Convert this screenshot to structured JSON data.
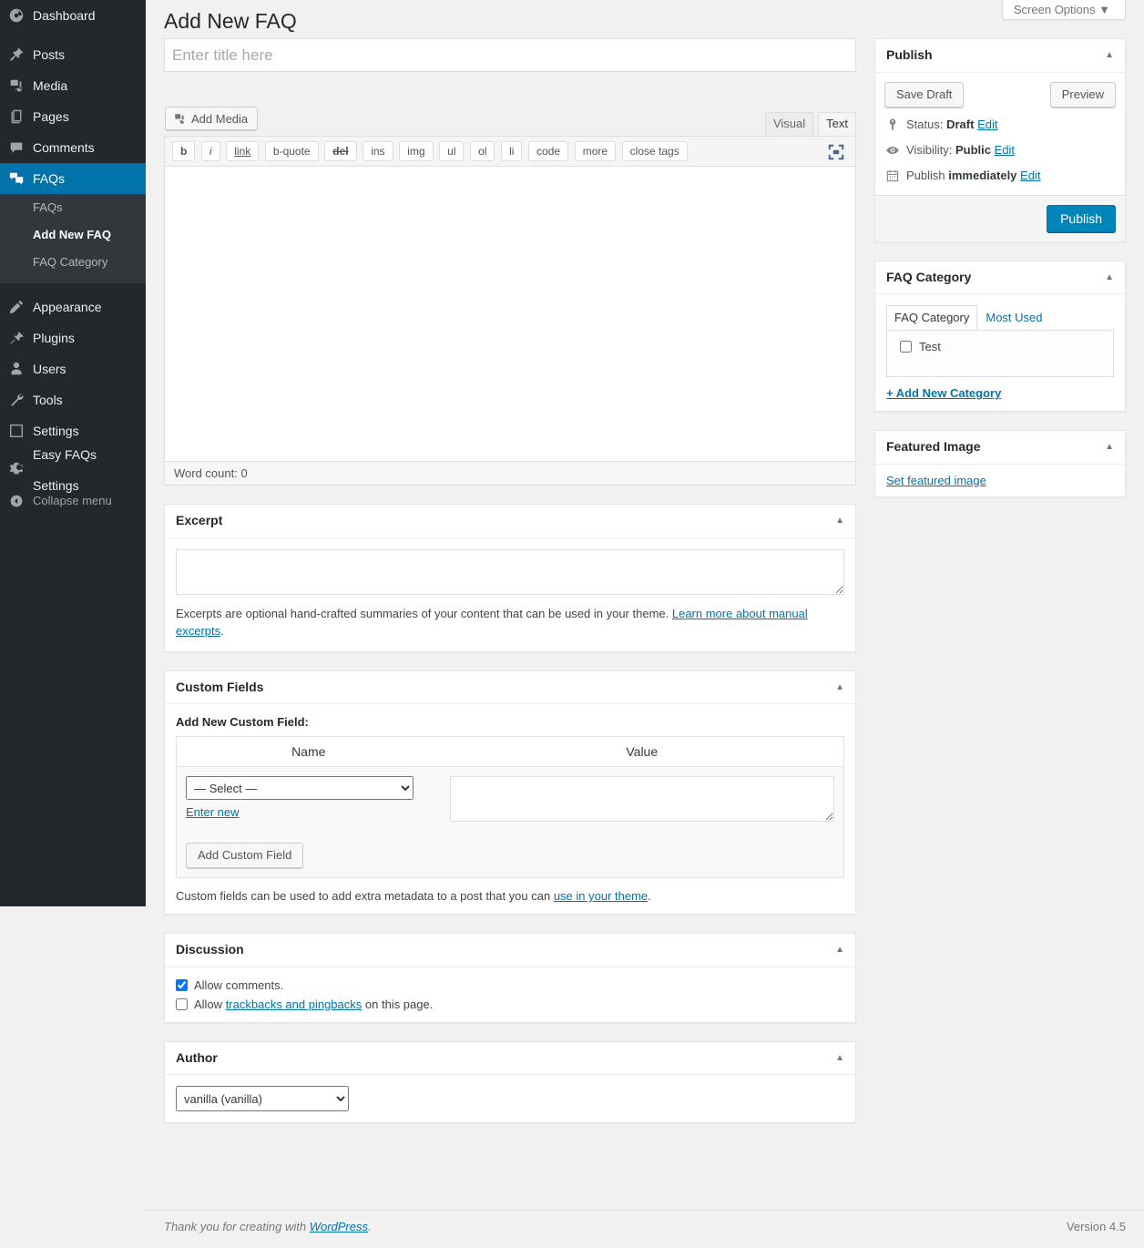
{
  "sidebar": {
    "items": [
      {
        "label": "Dashboard",
        "icon": "dashboard-icon"
      },
      {
        "label": "Posts",
        "icon": "pin-icon"
      },
      {
        "label": "Media",
        "icon": "media-icon"
      },
      {
        "label": "Pages",
        "icon": "pages-icon"
      },
      {
        "label": "Comments",
        "icon": "comments-icon"
      },
      {
        "label": "FAQs",
        "icon": "faqs-icon"
      },
      {
        "label": "Appearance",
        "icon": "appearance-icon"
      },
      {
        "label": "Plugins",
        "icon": "plugins-icon"
      },
      {
        "label": "Users",
        "icon": "users-icon"
      },
      {
        "label": "Tools",
        "icon": "tools-icon"
      },
      {
        "label": "Settings",
        "icon": "settings-icon"
      },
      {
        "label": "Easy FAQs Settings",
        "icon": "gear-icon"
      }
    ],
    "submenu": [
      {
        "label": "FAQs"
      },
      {
        "label": "Add New FAQ"
      },
      {
        "label": "FAQ Category"
      }
    ],
    "collapse_label": "Collapse menu",
    "active_item": "FAQs",
    "active_submenu": "Add New FAQ",
    "accent_color": "#0073aa",
    "background_color": "#23282d",
    "submenu_background": "#32373c"
  },
  "header": {
    "screen_options_label": "Screen Options",
    "page_title": "Add New FAQ"
  },
  "title_field": {
    "placeholder": "Enter title here",
    "value": ""
  },
  "editor": {
    "add_media_label": "Add Media",
    "tabs": [
      {
        "label": "Visual",
        "active": false
      },
      {
        "label": "Text",
        "active": true
      }
    ],
    "quicktags": [
      "b",
      "i",
      "link",
      "b-quote",
      "del",
      "ins",
      "img",
      "ul",
      "ol",
      "li",
      "code",
      "more",
      "close tags"
    ],
    "content": "",
    "status_info": "Word count: 0",
    "fullscreen_icon": "distraction-free-icon"
  },
  "excerpt": {
    "title": "Excerpt",
    "value": "",
    "howto_prefix": "Excerpts are optional hand-crafted summaries of your content that can be used in your theme. ",
    "howto_link": "Learn more about manual excerpts",
    "howto_suffix": "."
  },
  "custom_fields": {
    "title": "Custom Fields",
    "add_new_label": "Add New Custom Field:",
    "columns": [
      "Name",
      "Value"
    ],
    "select_value": "— Select —",
    "enter_new_label": "Enter new",
    "value_text": "",
    "add_button_label": "Add Custom Field",
    "footnote_prefix": "Custom fields can be used to add extra metadata to a post that you can ",
    "footnote_link": "use in your theme",
    "footnote_suffix": "."
  },
  "discussion": {
    "title": "Discussion",
    "allow_comments_label": "Allow comments.",
    "allow_comments_checked": true,
    "allow_trackbacks_prefix": "Allow ",
    "allow_trackbacks_link": "trackbacks and pingbacks",
    "allow_trackbacks_suffix": " on this page.",
    "allow_trackbacks_checked": false
  },
  "author": {
    "title": "Author",
    "selected": "vanilla (vanilla)"
  },
  "publish": {
    "title": "Publish",
    "save_draft_label": "Save Draft",
    "preview_label": "Preview",
    "status_label": "Status:",
    "status_value": "Draft",
    "status_edit": "Edit",
    "visibility_label": "Visibility:",
    "visibility_value": "Public",
    "visibility_edit": "Edit",
    "publish_label": "Publish",
    "publish_value": "immediately",
    "publish_edit": "Edit",
    "publish_button_label": "Publish",
    "button_color": "#0085ba"
  },
  "faq_category": {
    "title": "FAQ Category",
    "tabs": [
      {
        "label": "FAQ Category",
        "active": true
      },
      {
        "label": "Most Used",
        "active": false
      }
    ],
    "categories": [
      {
        "label": "Test",
        "checked": false
      }
    ],
    "add_new_label": "+ Add New Category"
  },
  "featured_image": {
    "title": "Featured Image",
    "set_label": "Set featured image"
  },
  "footer": {
    "thanks_prefix": "Thank you for creating with ",
    "thanks_link": "WordPress",
    "thanks_suffix": ".",
    "version": "Version 4.5"
  }
}
